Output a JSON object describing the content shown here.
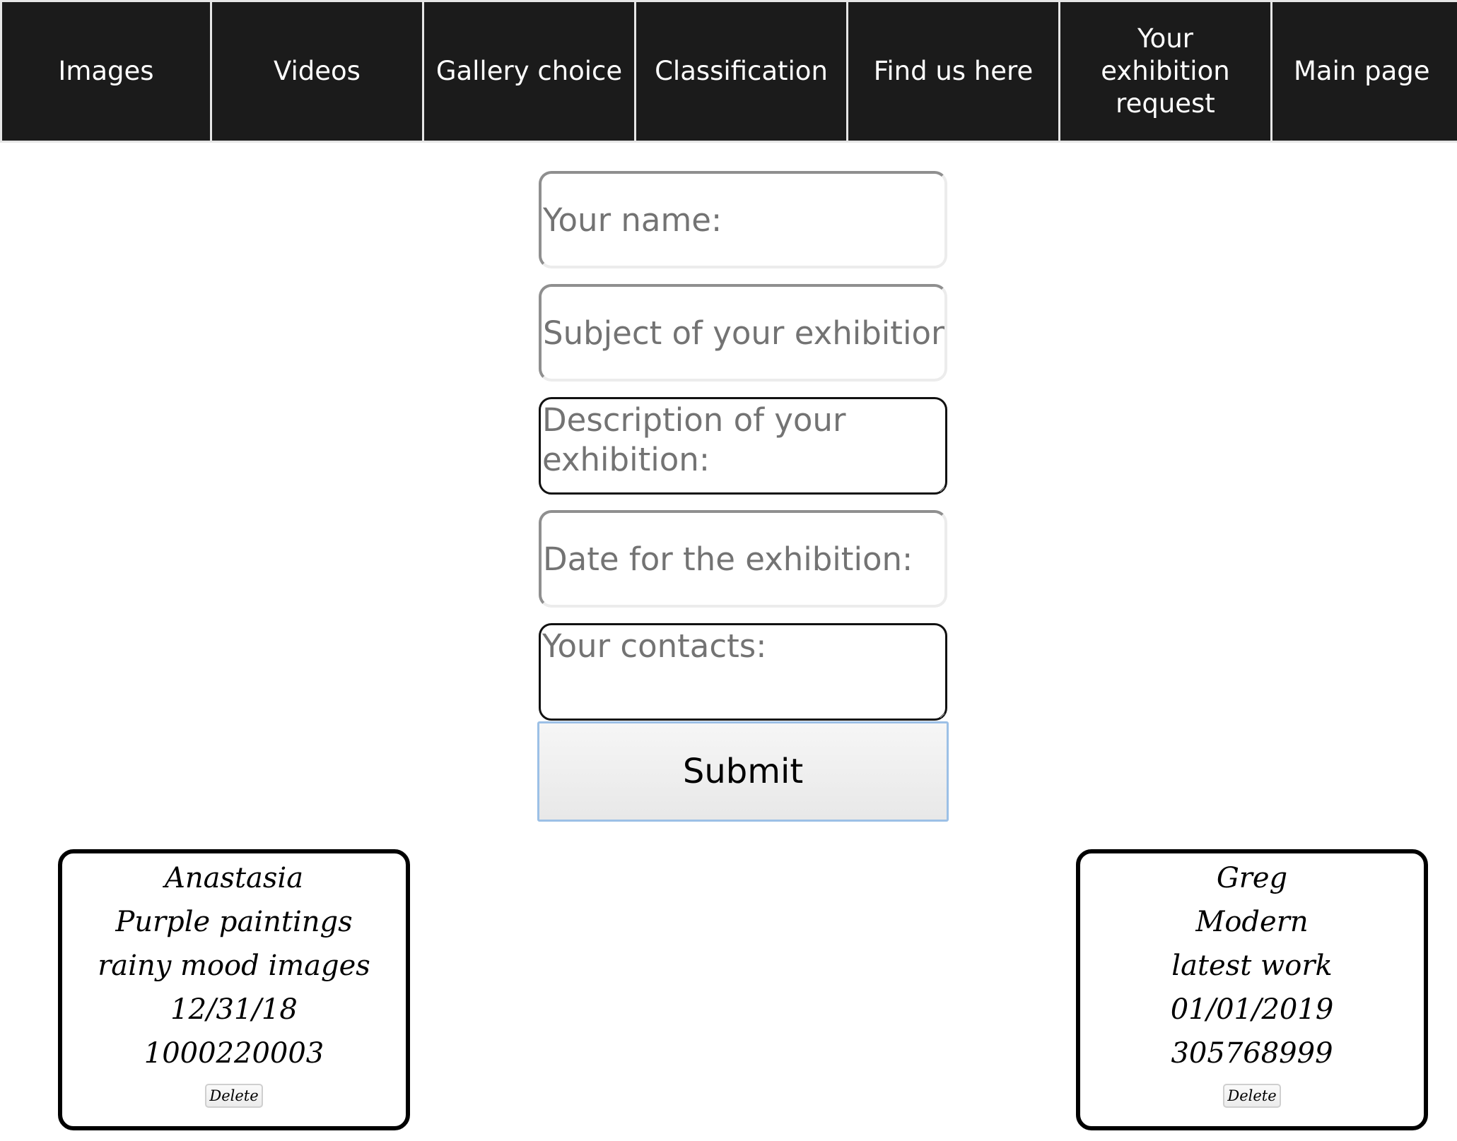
{
  "nav": {
    "items": [
      {
        "label": "Images"
      },
      {
        "label": "Videos"
      },
      {
        "label": "Gallery choice"
      },
      {
        "label": "Classification"
      },
      {
        "label": "Find us here"
      },
      {
        "label": "Your exhibition request"
      },
      {
        "label": "Main page"
      }
    ]
  },
  "form": {
    "name_placeholder": "Your name:",
    "subject_placeholder": "Subject of your exhibition:",
    "description_placeholder": "Description of your exhibition:",
    "date_placeholder": "Date for the exhibition:",
    "contacts_placeholder": "Your contacts:",
    "submit_label": "Submit"
  },
  "requests": [
    {
      "name": "Anastasia",
      "subject": "Purple paintings",
      "description": "rainy mood images",
      "date": "12/31/18",
      "contacts": "1000220003",
      "delete_label": "Delete"
    },
    {
      "name": "Greg",
      "subject": "Modern",
      "description": "latest work",
      "date": "01/01/2019",
      "contacts": "305768999",
      "delete_label": "Delete"
    }
  ],
  "colors": {
    "nav_background": "#1b1b1b",
    "nav_text": "#ffffff",
    "submit_border": "#9cc0e6",
    "card_border": "#000000"
  }
}
